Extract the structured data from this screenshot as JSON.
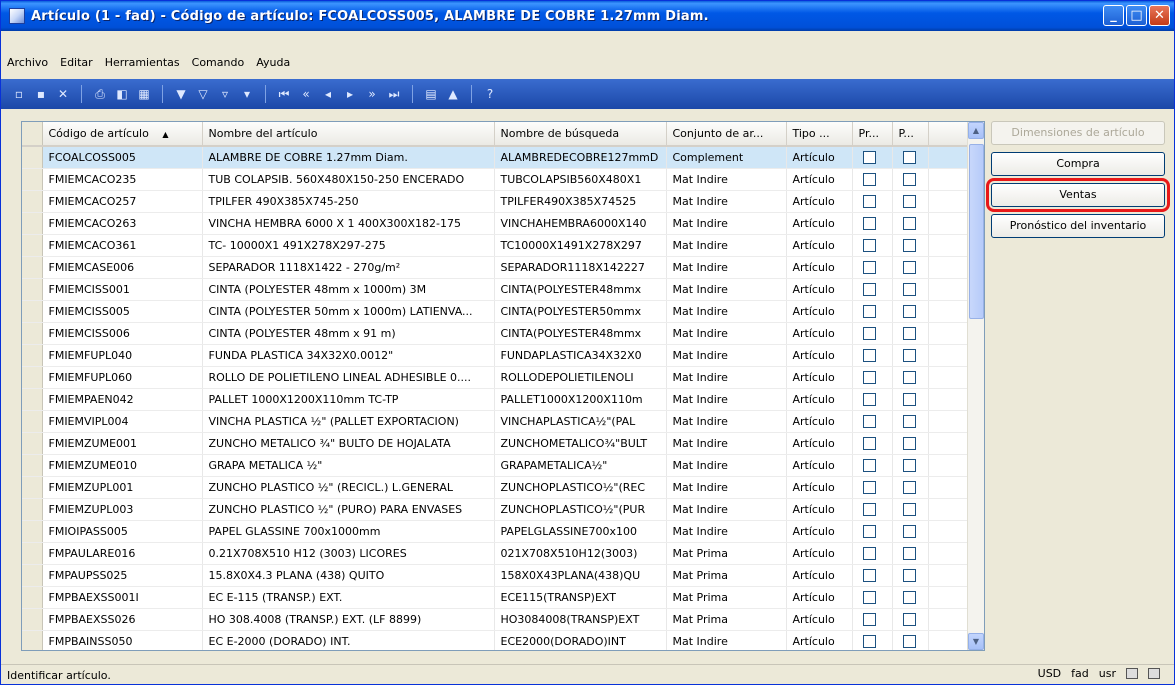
{
  "window": {
    "title": "Artículo (1 - fad) - Código de artículo: FCOALCOSS005, ALAMBRE DE COBRE 1.27mm Diam."
  },
  "menu": [
    "Archivo",
    "Editar",
    "Herramientas",
    "Comando",
    "Ayuda"
  ],
  "grid": {
    "columns": [
      "Código de artículo",
      "Nombre del artículo",
      "Nombre de búsqueda",
      "Conjunto de ar...",
      "Tipo ...",
      "Pr...",
      "P..."
    ],
    "rows": [
      [
        "FCOALCOSS005",
        "ALAMBRE DE COBRE 1.27mm Diam.",
        "ALAMBREDECOBRE127mmD",
        "Complement",
        "Artículo"
      ],
      [
        "FMIEMCACO235",
        "TUB COLAPSIB. 560X480X150-250 ENCERADO",
        "TUBCOLAPSIB560X480X1",
        "Mat Indire",
        "Artículo"
      ],
      [
        "FMIEMCACO257",
        "TPILFER 490X385X745-250",
        "TPILFER490X385X74525",
        "Mat Indire",
        "Artículo"
      ],
      [
        "FMIEMCACO263",
        "VINCHA HEMBRA 6000 X 1 400X300X182-175",
        "VINCHAHEMBRA6000X140",
        "Mat Indire",
        "Artículo"
      ],
      [
        "FMIEMCACO361",
        "TC- 10000X1 491X278X297-275",
        "TC10000X1491X278X297",
        "Mat Indire",
        "Artículo"
      ],
      [
        "FMIEMCASE006",
        "SEPARADOR 1118X1422 - 270g/m²",
        "SEPARADOR1118X142227",
        "Mat Indire",
        "Artículo"
      ],
      [
        "FMIEMCISS001",
        "CINTA (POLYESTER 48mm x 1000m) 3M",
        "CINTA(POLYESTER48mmx",
        "Mat Indire",
        "Artículo"
      ],
      [
        "FMIEMCISS005",
        "CINTA (POLYESTER 50mm x 1000m) LATIENVA...",
        "CINTA(POLYESTER50mmx",
        "Mat Indire",
        "Artículo"
      ],
      [
        "FMIEMCISS006",
        "CINTA (POLYESTER 48mm x 91 m)",
        "CINTA(POLYESTER48mmx",
        "Mat Indire",
        "Artículo"
      ],
      [
        "FMIEMFUPL040",
        "FUNDA PLASTICA 34X32X0.0012\"",
        "FUNDAPLASTICA34X32X0",
        "Mat Indire",
        "Artículo"
      ],
      [
        "FMIEMFUPL060",
        "ROLLO DE POLIETILENO LINEAL ADHESIBLE 0....",
        "ROLLODEPOLIETILENOLI",
        "Mat Indire",
        "Artículo"
      ],
      [
        "FMIEMPAEN042",
        "PALLET 1000X1200X110mm TC-TP",
        "PALLET1000X1200X110m",
        "Mat Indire",
        "Artículo"
      ],
      [
        "FMIEMVIPL004",
        "VINCHA PLASTICA ½\" (PALLET EXPORTACION)",
        "VINCHAPLASTICA½\"(PAL",
        "Mat Indire",
        "Artículo"
      ],
      [
        "FMIEMZUME001",
        "ZUNCHO METALICO ¾\" BULTO DE HOJALATA",
        "ZUNCHOMETALICO¾\"BULT",
        "Mat Indire",
        "Artículo"
      ],
      [
        "FMIEMZUME010",
        "GRAPA METALICA ½\"",
        "GRAPAMETALICA½\"",
        "Mat Indire",
        "Artículo"
      ],
      [
        "FMIEMZUPL001",
        "ZUNCHO PLASTICO ½\" (RECICL.) L.GENERAL",
        "ZUNCHOPLASTICO½\"(REC",
        "Mat Indire",
        "Artículo"
      ],
      [
        "FMIEMZUPL003",
        "ZUNCHO PLASTICO ½\" (PURO) PARA ENVASES",
        "ZUNCHOPLASTICO½\"(PUR",
        "Mat Indire",
        "Artículo"
      ],
      [
        "FMIOIPASS005",
        "PAPEL GLASSINE 700x1000mm",
        "PAPELGLASSINE700x100",
        "Mat Indire",
        "Artículo"
      ],
      [
        "FMPAULARE016",
        "0.21X708X510 H12 (3003) LICORES",
        "021X708X510H12(3003)",
        "Mat Prima",
        "Artículo"
      ],
      [
        "FMPAUPSS025",
        "15.8X0X4.3 PLANA (438) QUITO",
        "158X0X43PLANA(438)QU",
        "Mat Prima",
        "Artículo"
      ],
      [
        "FMPBAEXSS001I",
        "EC E-115 (TRANSP.) EXT.",
        "ECE115(TRANSP)EXT",
        "Mat Prima",
        "Artículo"
      ],
      [
        "FMPBAEXSS026",
        "HO 308.4008 (TRANSP.) EXT. (LF 8899)",
        "HO3084008(TRANSP)EXT",
        "Mat Prima",
        "Artículo"
      ],
      [
        "FMPBAINSS050",
        "EC E-2000 (DORADO) INT.",
        "ECE2000(DORADO)INT",
        "Mat Indire",
        "Artículo"
      ]
    ]
  },
  "side_buttons": {
    "dimensiones": "Dimensiones de artículo",
    "compra": "Compra",
    "ventas": "Ventas",
    "pronostico": "Pronóstico del inventario"
  },
  "status": {
    "text": "Identificar artículo.",
    "currency": "USD",
    "company": "fad",
    "layer": "usr"
  },
  "colors": {
    "title_bar": "#0058e6",
    "selected_row": "#cfe6f7",
    "highlight_border": "#e81818"
  }
}
